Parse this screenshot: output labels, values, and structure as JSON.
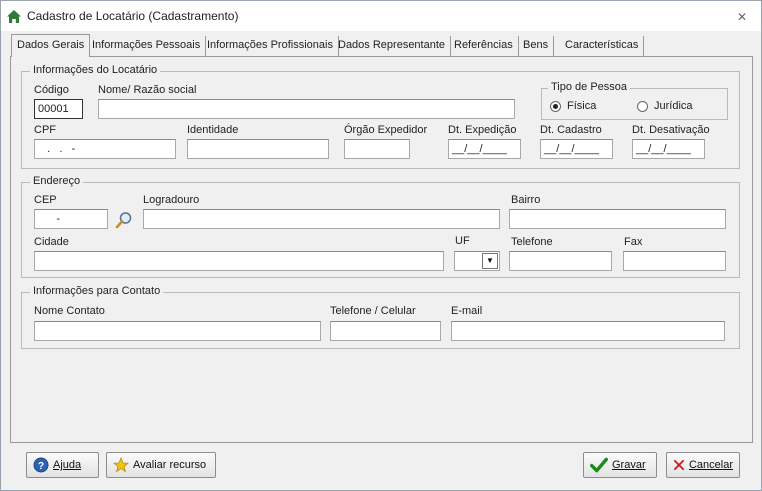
{
  "window": {
    "title": "Cadastro de Locatário (Cadastramento)"
  },
  "tabs": [
    {
      "label": "Dados Gerais",
      "active": true
    },
    {
      "label": "Informações Pessoais"
    },
    {
      "label": "Informações Profissionais"
    },
    {
      "label": "Dados Representante"
    },
    {
      "label": "Referências"
    },
    {
      "label": "Bens"
    },
    {
      "label": "Características"
    }
  ],
  "locatario": {
    "legend": "Informações do Locatário",
    "codigo_label": "Código",
    "codigo_value": "00001",
    "nome_label": "Nome/ Razão social",
    "nome_value": "",
    "tipo_pessoa_legend": "Tipo de Pessoa",
    "fisica_label": "Física",
    "juridica_label": "Jurídica",
    "selected_tipo": "Física",
    "cpf_label": "CPF",
    "cpf_value": "   .   .   -",
    "identidade_label": "Identidade",
    "orgao_label": "Órgão Expedidor",
    "dt_expedicao_label": "Dt. Expedição",
    "dt_expedicao_value": "__/__/____",
    "dt_cadastro_label": "Dt. Cadastro",
    "dt_cadastro_value": "__/__/____",
    "dt_desativacao_label": "Dt. Desativação",
    "dt_desativacao_value": "__/__/____"
  },
  "endereco": {
    "legend": "Endereço",
    "cep_label": "CEP",
    "cep_value": "      -",
    "logradouro_label": "Logradouro",
    "bairro_label": "Bairro",
    "cidade_label": "Cidade",
    "uf_label": "UF",
    "telefone_label": "Telefone",
    "fax_label": "Fax"
  },
  "contato": {
    "legend": "Informações para Contato",
    "nome_contato_label": "Nome Contato",
    "telefone_celular_label": "Telefone / Celular",
    "email_label": "E-mail"
  },
  "buttons": {
    "ajuda": "Ajuda",
    "avaliar": "Avaliar recurso",
    "gravar": "Gravar",
    "cancelar": "Cancelar"
  },
  "colors": {
    "check_green": "#1e8a1e",
    "cancel_red": "#d01818",
    "help_blue": "#2a63b8",
    "star_yellow": "#f2c21b",
    "home_green": "#2f7a3a"
  }
}
